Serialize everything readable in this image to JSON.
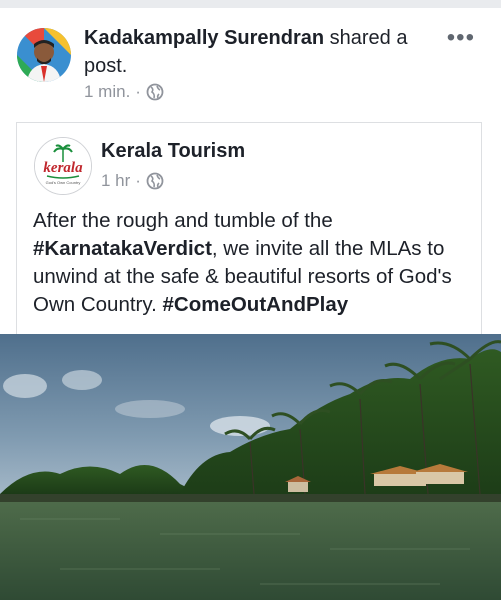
{
  "post": {
    "sharer_name": "Kadakampally Surendran",
    "action_text": " shared a post.",
    "time": "1 min.",
    "separator": "·",
    "privacy_icon": "globe-icon",
    "more_icon": "more-options-icon",
    "more_glyph": "•••"
  },
  "shared": {
    "page_name": "Kerala Tourism",
    "logo_text": "kerala",
    "logo_tagline": "God's Own Country",
    "time": "1 hr",
    "separator": "·",
    "privacy_icon": "globe-icon",
    "text_part1": "After the rough and tumble of the ",
    "hashtag1": "#KarnatakaVerdict",
    "text_part2": ", we invite all the MLAs to unwind at the safe & beautiful resorts of God's Own Country. ",
    "hashtag2": "#ComeOutAndPlay"
  },
  "colors": {
    "text_primary": "#1d2129",
    "text_secondary": "#90949c",
    "divider": "#dddfe2",
    "logo_red": "#c0272d",
    "logo_green": "#1a8f3c"
  }
}
